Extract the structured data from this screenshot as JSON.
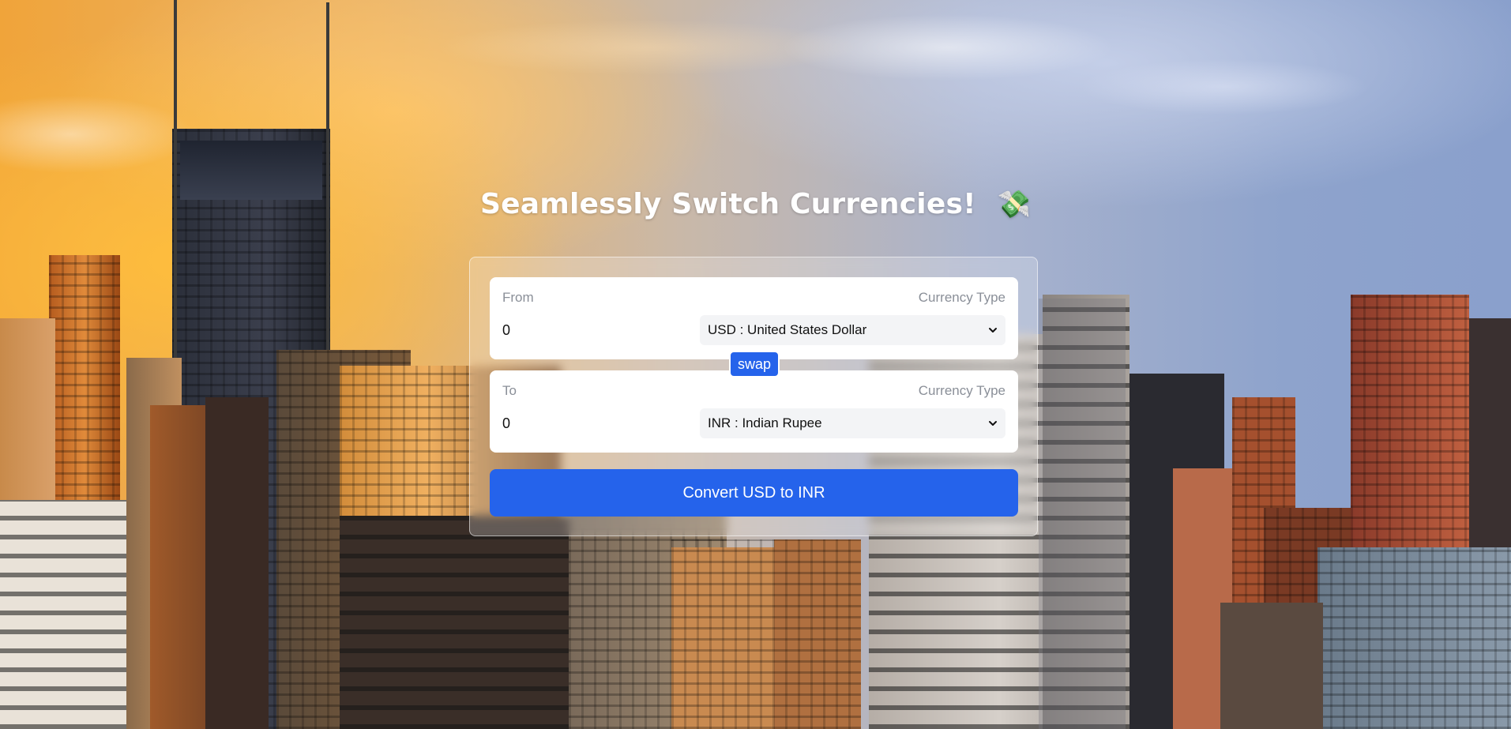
{
  "header": {
    "title": "Seamlessly Switch Currencies!",
    "title_icon": "money-with-wings-icon"
  },
  "converter": {
    "from": {
      "label": "From",
      "currency_type_label": "Currency Type",
      "amount": "0",
      "selected_currency": "USD : United States Dollar"
    },
    "to": {
      "label": "To",
      "currency_type_label": "Currency Type",
      "amount": "0",
      "selected_currency": "INR : Indian Rupee"
    },
    "swap_label": "swap",
    "convert_label": "Convert USD to INR"
  },
  "colors": {
    "accent": "#2563eb",
    "card": "#ffffff",
    "muted_text": "#8a8f98"
  }
}
